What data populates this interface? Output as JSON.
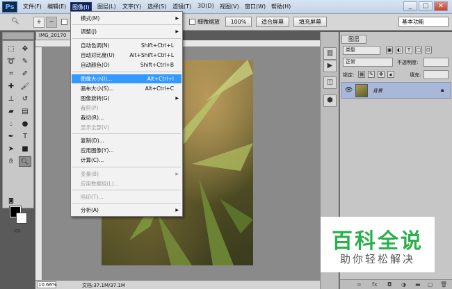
{
  "app": {
    "logo": "Ps"
  },
  "menubar": {
    "items": [
      "文件(F)",
      "编辑(E)",
      "图像(I)",
      "图层(L)",
      "文字(Y)",
      "选择(S)",
      "滤镜(T)",
      "3D(D)",
      "视图(V)",
      "窗口(W)",
      "帮助(H)"
    ],
    "active_index": 2,
    "window_controls": [
      "_",
      "□",
      "✕"
    ]
  },
  "options_bar": {
    "scrubby_zoom_label": "细微缩放",
    "zoom_value": "100%",
    "fit_screen": "适合屏幕",
    "fill_screen": "填充屏幕",
    "workspace": "基本功能"
  },
  "document": {
    "tab_title": "IMG_20170",
    "zoom": "10.66%",
    "doc_info": "文档:37.1M/37.1M"
  },
  "image_menu": {
    "items": [
      {
        "label": "模式(M)",
        "shortcut": "",
        "submenu": true,
        "enabled": true
      },
      {
        "label": "调整(J)",
        "shortcut": "",
        "submenu": true,
        "enabled": true
      },
      {
        "label": "自动色调(N)",
        "shortcut": "Shift+Ctrl+L",
        "submenu": false,
        "enabled": true
      },
      {
        "label": "自动对比度(U)",
        "shortcut": "Alt+Shift+Ctrl+L",
        "submenu": false,
        "enabled": true
      },
      {
        "label": "自动颜色(O)",
        "shortcut": "Shift+Ctrl+B",
        "submenu": false,
        "enabled": true
      },
      {
        "label": "图像大小(I)...",
        "shortcut": "Alt+Ctrl+I",
        "submenu": false,
        "enabled": true,
        "highlighted": true
      },
      {
        "label": "画布大小(S)...",
        "shortcut": "Alt+Ctrl+C",
        "submenu": false,
        "enabled": true
      },
      {
        "label": "图像旋转(G)",
        "shortcut": "",
        "submenu": true,
        "enabled": true
      },
      {
        "label": "裁剪(P)",
        "shortcut": "",
        "submenu": false,
        "enabled": false
      },
      {
        "label": "裁切(R)...",
        "shortcut": "",
        "submenu": false,
        "enabled": true
      },
      {
        "label": "显示全部(V)",
        "shortcut": "",
        "submenu": false,
        "enabled": false
      },
      {
        "label": "复制(D)...",
        "shortcut": "",
        "submenu": false,
        "enabled": true
      },
      {
        "label": "应用图像(Y)...",
        "shortcut": "",
        "submenu": false,
        "enabled": true
      },
      {
        "label": "计算(C)...",
        "shortcut": "",
        "submenu": false,
        "enabled": true
      },
      {
        "label": "变量(B)",
        "shortcut": "",
        "submenu": true,
        "enabled": false
      },
      {
        "label": "应用数据组(L)...",
        "shortcut": "",
        "submenu": false,
        "enabled": false
      },
      {
        "label": "陷印(T)...",
        "shortcut": "",
        "submenu": false,
        "enabled": false
      },
      {
        "label": "分析(A)",
        "shortcut": "",
        "submenu": true,
        "enabled": true
      }
    ]
  },
  "layers_panel": {
    "tab": "图层",
    "filter_kind": "类型",
    "blend_mode": "正常",
    "opacity_label": "不透明度:",
    "lock_label": "锁定:",
    "fill_label": "填充:",
    "layer_name": "背景"
  },
  "watermark": {
    "title": "百科全说",
    "subtitle": "助你轻松解决"
  },
  "colors": {
    "menu_highlight": "#3399ff",
    "layer_selected": "#a9b8d8",
    "watermark_green": "#28b04a"
  }
}
